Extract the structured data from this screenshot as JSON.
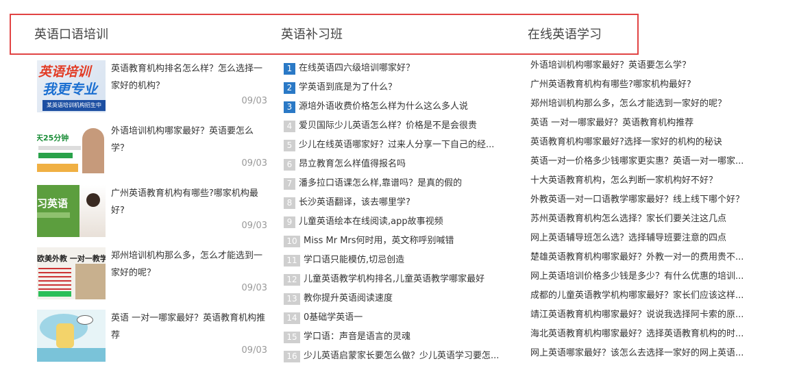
{
  "tabs": [
    "英语口语培训",
    "英语补习班",
    "在线英语学习"
  ],
  "articles": [
    {
      "title": "英语教育机构排名怎么样？怎么选择一家好的机构？",
      "date": "09/03",
      "thumb": {
        "line1": "英语培训",
        "line2": "我更专业",
        "line3": "某英语培训机构招生中"
      }
    },
    {
      "title": "外语培训机构哪家最好？英语要怎么学？",
      "date": "09/03",
      "thumb": {
        "line1": "天25分钟"
      }
    },
    {
      "title": "广州英语教育机构有哪些?哪家机构最好?",
      "date": "09/03",
      "thumb": {
        "line1": "习英语"
      }
    },
    {
      "title": "郑州培训机构那么多，怎么才能选到一家好的呢？",
      "date": "09/03",
      "thumb": {
        "line1": "欧美外教 一对一教学"
      }
    },
    {
      "title": "英语 一对一哪家最好？英语教育机构推荐",
      "date": "09/03",
      "thumb": {}
    }
  ],
  "ranked": [
    {
      "n": "1",
      "t": "在线英语四六级培训哪家好？"
    },
    {
      "n": "2",
      "t": "学英语到底是为了什么？"
    },
    {
      "n": "3",
      "t": "源培外语收费价格怎么样为什么这么多人说"
    },
    {
      "n": "4",
      "t": "爱贝国际少儿英语怎么样？价格是不是会很贵"
    },
    {
      "n": "5",
      "t": "少儿在线英语哪家好？过来人分享一下自己的经..."
    },
    {
      "n": "6",
      "t": "昂立教育怎么样值得报名吗"
    },
    {
      "n": "7",
      "t": "潘多拉口语课怎么样,靠谱吗？是真的假的"
    },
    {
      "n": "8",
      "t": "长沙英语翻译，该去哪里学?"
    },
    {
      "n": "9",
      "t": "儿童英语绘本在线阅读,app故事视频"
    },
    {
      "n": "10",
      "t": "Miss Mr Mrs何时用，英文称呼别喊错"
    },
    {
      "n": "11",
      "t": "学口语只能模仿,切忌创造"
    },
    {
      "n": "12",
      "t": "儿童英语教学机构排名,儿童英语教学哪家最好"
    },
    {
      "n": "13",
      "t": "教你提升英语阅读速度"
    },
    {
      "n": "14",
      "t": "0基础学英语一"
    },
    {
      "n": "15",
      "t": "学口语：声音是语言的灵魂"
    },
    {
      "n": "16",
      "t": "少儿英语启蒙家长要怎么做？少儿英语学习要怎..."
    }
  ],
  "links": [
    "外语培训机构哪家最好？英语要怎么学？",
    "广州英语教育机构有哪些?哪家机构最好?",
    "郑州培训机构那么多，怎么才能选到一家好的呢？",
    "英语 一对一哪家最好？英语教育机构推荐",
    "英语教育机构哪家最好?选择一家好的机构的秘诀",
    "英语一对一价格多少钱哪家更实惠？英语一对一哪家...",
    "十大英语教育机构，怎么判断一家机构好不好？",
    "外教英语一对一口语教学哪家最好？线上线下哪个好？",
    "苏州英语教育机构怎么选择？家长们要关注这几点",
    "网上英语辅导班怎么选？选择辅导班要注意的四点",
    "楚雄英语教育机构哪家最好？外教一对一的费用贵不...",
    "网上英语培训价格多少钱是多少？有什么优惠的培训...",
    "成都的儿童英语教学机构哪家最好？家长们应该这样...",
    "靖江英语教育机构哪家最好？说说我选择阿卡索的原...",
    "海北英语教育机构哪家最好？选择英语教育机构的时...",
    "网上英语哪家最好？该怎么去选择一家好的网上英语..."
  ]
}
